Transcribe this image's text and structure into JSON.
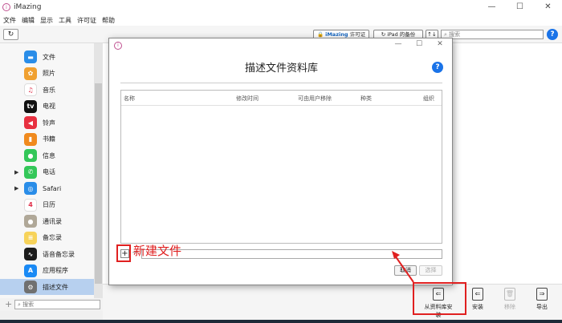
{
  "app": {
    "title": "iMazing"
  },
  "window_controls": {
    "minimize": "—",
    "maximize": "☐",
    "close": "✕"
  },
  "menu": [
    "文件",
    "编辑",
    "显示",
    "工具",
    "许可证",
    "帮助"
  ],
  "toolbar": {
    "refresh": "↻",
    "license_brand": "iMazing",
    "license_label": "许可证",
    "backup_label": "iPad 的备份",
    "sort": "↑↓",
    "search_placeholder": "搜索",
    "help": "?"
  },
  "sidebar": {
    "items": [
      {
        "label": "文件",
        "icon": "folder-icon",
        "color": "#2a8de8",
        "glyph": "▬",
        "arrow": ""
      },
      {
        "label": "照片",
        "icon": "photos-icon",
        "color": "#f0a030",
        "glyph": "✿",
        "arrow": ""
      },
      {
        "label": "音乐",
        "icon": "music-icon",
        "color": "#ffffff",
        "glyph": "♫",
        "arrow": ""
      },
      {
        "label": "电视",
        "icon": "tv-icon",
        "color": "#111111",
        "glyph": "tv",
        "arrow": ""
      },
      {
        "label": "铃声",
        "icon": "ringtone-icon",
        "color": "#e83040",
        "glyph": "◀",
        "arrow": ""
      },
      {
        "label": "书籍",
        "icon": "books-icon",
        "color": "#f08a1e",
        "glyph": "▮",
        "arrow": ""
      },
      {
        "label": "信息",
        "icon": "messages-icon",
        "color": "#34c759",
        "glyph": "●",
        "arrow": ""
      },
      {
        "label": "电话",
        "icon": "phone-icon",
        "color": "#34c759",
        "glyph": "✆",
        "arrow": "▶"
      },
      {
        "label": "Safari",
        "icon": "safari-icon",
        "color": "#2a8de8",
        "glyph": "◎",
        "arrow": "▶"
      },
      {
        "label": "日历",
        "icon": "calendar-icon",
        "color": "#ffffff",
        "glyph": "4",
        "arrow": ""
      },
      {
        "label": "通讯录",
        "icon": "contacts-icon",
        "color": "#b0a898",
        "glyph": "●",
        "arrow": ""
      },
      {
        "label": "备忘录",
        "icon": "notes-icon",
        "color": "#f7d35a",
        "glyph": "≡",
        "arrow": ""
      },
      {
        "label": "语音备忘录",
        "icon": "voice-memo-icon",
        "color": "#1c1c1c",
        "glyph": "∿",
        "arrow": ""
      },
      {
        "label": "应用程序",
        "icon": "appstore-icon",
        "color": "#1a8af5",
        "glyph": "A",
        "arrow": ""
      },
      {
        "label": "描述文件",
        "icon": "profile-gear-icon",
        "color": "#707070",
        "glyph": "⚙",
        "arrow": ""
      }
    ],
    "search_placeholder": "搜索",
    "add": "+"
  },
  "dialog": {
    "title": "描述文件资料库",
    "help": "?",
    "columns": [
      "名称",
      "修改时间",
      "可由用户移除",
      "种类",
      "组织"
    ],
    "add": "+",
    "remove": "−",
    "cancel": "取消",
    "select": "选择"
  },
  "annotation": {
    "text": "新建文件",
    "color": "#e02020"
  },
  "bottom_toolbar": [
    {
      "label": "从资料库安装",
      "icon": "install-from-library-icon",
      "glyph": "⇐",
      "disabled": false
    },
    {
      "label": "安装",
      "icon": "install-icon",
      "glyph": "⇐",
      "disabled": false
    },
    {
      "label": "移除",
      "icon": "trash-icon",
      "glyph": "🗑",
      "disabled": true
    },
    {
      "label": "导出",
      "icon": "export-icon",
      "glyph": "⇒",
      "disabled": false
    }
  ]
}
